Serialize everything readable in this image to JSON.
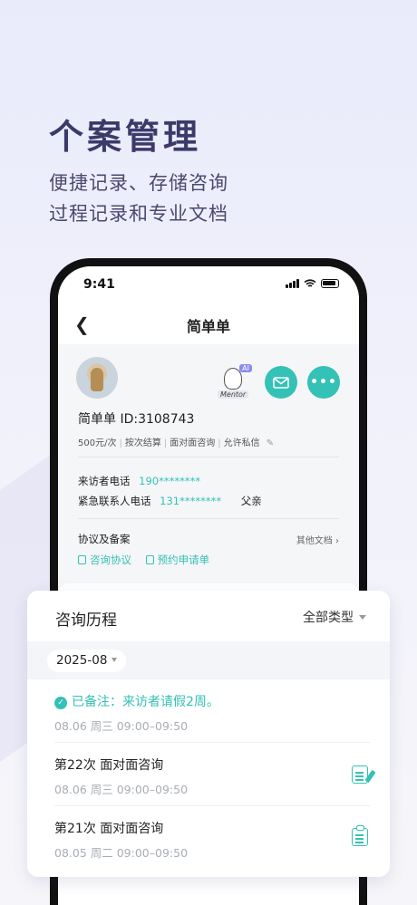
{
  "promo": {
    "headline": "个案管理",
    "subline1": "便捷记录、存储咨询",
    "subline2": "过程记录和专业文档"
  },
  "status_bar": {
    "time": "9:41"
  },
  "nav": {
    "back_icon": "chevron-left-icon",
    "title": "简单单"
  },
  "profile": {
    "name_id": "简单单  ID:3108743",
    "mentor_ai_badge": "AI",
    "mentor_tag": "Mentor",
    "tags": [
      "500元/次",
      "按次结算",
      "面对面咨询",
      "允许私信"
    ],
    "visitor_phone_label": "来访者电话",
    "visitor_phone_value": "190********",
    "emergency_label": "紧急联系人电话",
    "emergency_value": "131********",
    "emergency_relation": "父亲",
    "agreement_title": "协议及备案",
    "other_docs": "其他文档",
    "doc_links": [
      "咨询协议",
      "预约申请单"
    ]
  },
  "history": {
    "title": "咨询历程",
    "filter": "全部类型",
    "month": "2025-08",
    "records": [
      {
        "title": "已备注：来访者请假2周。",
        "time": "08.06 周三 09:00–09:50",
        "type": "note"
      },
      {
        "title": "第22次  面对面咨询",
        "time": "08.06 周三 09:00–09:50",
        "type": "session",
        "icon": "edit-note-icon"
      },
      {
        "title": "第21次  面对面咨询",
        "time": "08.05 周二 09:00–09:50",
        "type": "session",
        "icon": "clipboard-icon"
      }
    ]
  },
  "colors": {
    "accent": "#34c1b6",
    "headline": "#3b3a6a"
  }
}
